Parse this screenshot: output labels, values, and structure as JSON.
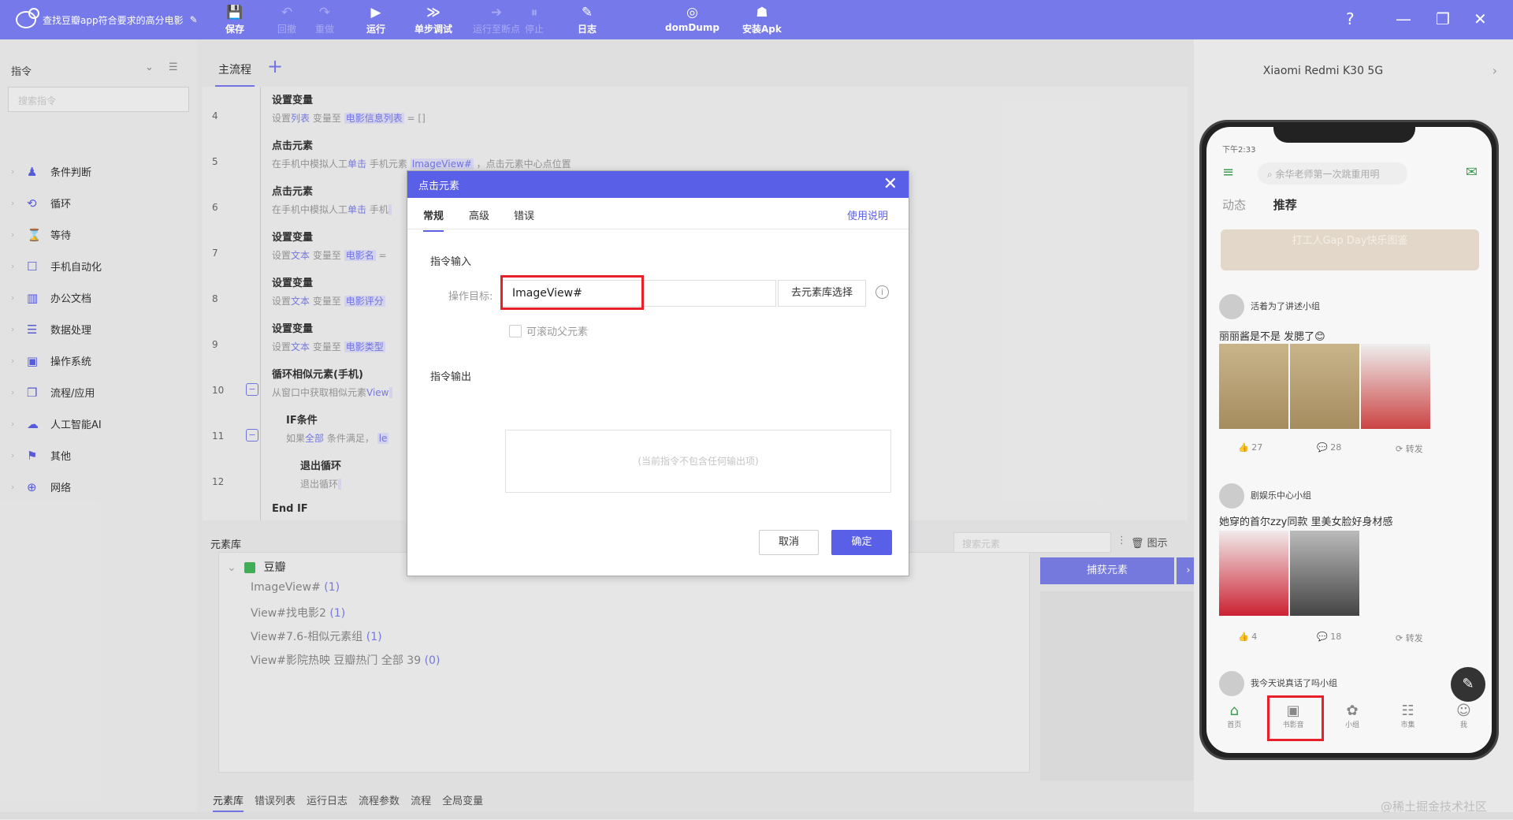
{
  "app": {
    "title": "查找豆瓣app符合要求的高分电影"
  },
  "toolbar": [
    {
      "label": "保存",
      "icon": "💾",
      "dim": false
    },
    {
      "label": "回撤",
      "icon": "↶",
      "dim": true
    },
    {
      "label": "重做",
      "icon": "↷",
      "dim": true
    },
    {
      "label": "运行",
      "icon": "▶",
      "dim": false
    },
    {
      "label": "单步调试",
      "icon": "≫",
      "dim": false
    },
    {
      "label": "运行至断点",
      "icon": "➔",
      "dim": true
    },
    {
      "label": "停止",
      "icon": "⏸",
      "dim": true
    },
    {
      "label": "日志",
      "icon": "✎",
      "dim": false
    },
    {
      "label": "domDump",
      "icon": "◎",
      "dim": false
    },
    {
      "label": "安装Apk",
      "icon": "☗",
      "dim": false
    }
  ],
  "left": {
    "header": "指令",
    "search_placeholder": "搜索指令",
    "categories": [
      "条件判断",
      "循环",
      "等待",
      "手机自动化",
      "办公文档",
      "数据处理",
      "操作系统",
      "流程/应用",
      "人工智能AI",
      "其他",
      "网络"
    ]
  },
  "flow": {
    "tab_main": "主流程",
    "steps": [
      {
        "num": "4",
        "title": "设置变量",
        "desc_a": "设置",
        "desc_b": "列表",
        "desc_c": "变量至",
        "desc_d": "电影信息列表",
        "desc_e": "= []"
      },
      {
        "num": "5",
        "title": "点击元素",
        "desc_a": "在手机中模拟人工",
        "desc_b": "单击",
        "desc_c": "手机元素",
        "desc_d": "ImageView#",
        "desc_e": "，点击元素中心点位置"
      },
      {
        "num": "6",
        "title": "点击元素",
        "desc_a": "在手机中模拟人工",
        "desc_b": "单击",
        "desc_c": "手机",
        "desc_d": "",
        "desc_e": ""
      },
      {
        "num": "7",
        "title": "设置变量",
        "desc_a": "设置",
        "desc_b": "文本",
        "desc_c": "变量至",
        "desc_d": "电影名",
        "desc_e": "="
      },
      {
        "num": "8",
        "title": "设置变量",
        "desc_a": "设置",
        "desc_b": "文本",
        "desc_c": "变量至",
        "desc_d": "电影评分",
        "desc_e": ""
      },
      {
        "num": "9",
        "title": "设置变量",
        "desc_a": "设置",
        "desc_b": "文本",
        "desc_c": "变量至",
        "desc_d": "电影类型",
        "desc_e": ""
      },
      {
        "num": "10",
        "title": "循环相似元素(手机)",
        "desc_a": "从窗口中获取相似元素",
        "desc_b": "View",
        "desc_c": "",
        "desc_d": "",
        "desc_e": ""
      },
      {
        "num": "11",
        "title": "IF条件",
        "desc_a": "如果",
        "desc_b": "全部",
        "desc_c": "条件满足，",
        "desc_d": "le",
        "desc_e": ""
      },
      {
        "num": "12",
        "title": "退出循环",
        "desc_a": "退出循环",
        "desc_b": "",
        "desc_c": "",
        "desc_d": "",
        "desc_e": ""
      }
    ],
    "end_if": "End IF",
    "collapse": "−"
  },
  "elements": {
    "header": "元素库",
    "root": "豆瓣",
    "items": [
      {
        "name": "ImageView#",
        "count": "(1)"
      },
      {
        "name": "View#找电影2",
        "count": "(1)"
      },
      {
        "name": "View#7.6-相似元素组",
        "count": "(1)"
      },
      {
        "name": "View#影院热映 豆瓣热门 全部 39",
        "count": "(0)"
      }
    ],
    "search_placeholder": "搜索元素",
    "view_label": "图示",
    "capture_label": "捕获元素"
  },
  "bottom_tabs": [
    "元素库",
    "错误列表",
    "运行日志",
    "流程参数",
    "流程",
    "全局变量"
  ],
  "device": {
    "name": "Xiaomi Redmi K30 5G",
    "status": "下午2:33",
    "search_text": "余华老师第一次跳重用明",
    "tab_a": "动态",
    "tab_b": "推荐",
    "banner": "打工人Gap Day快乐图鉴",
    "group1": "活着为了讲述小组",
    "post1": "丽丽酱是不是  发腮了😊",
    "likes1": "27",
    "comments1": "28",
    "share": "转发",
    "group2": "剧娱乐中心小组",
    "post2": "她穿的首尔zzy同款  里美女脸好身材感",
    "likes2": "4",
    "comments2": "18",
    "group3": "我今天说真话了吗小组",
    "nav": [
      "首页",
      "书影音",
      "小组",
      "市集",
      "我"
    ]
  },
  "dialog": {
    "title": "点击元素",
    "tabs": [
      "常规",
      "高级",
      "错误"
    ],
    "help": "使用说明",
    "input_section": "指令输入",
    "target_label": "操作目标:",
    "target_value": "ImageView#",
    "pick_button": "去元素库选择",
    "scroll_parent": "可滚动父元素",
    "output_section": "指令输出",
    "no_output": "(当前指令不包含任何输出项)",
    "cancel": "取消",
    "ok": "确定"
  },
  "watermark": "@稀土掘金技术社区",
  "colors": {
    "accent": "#7679e9",
    "dialog_accent": "#5a5fe8",
    "highlight_box": "#e8202a"
  }
}
